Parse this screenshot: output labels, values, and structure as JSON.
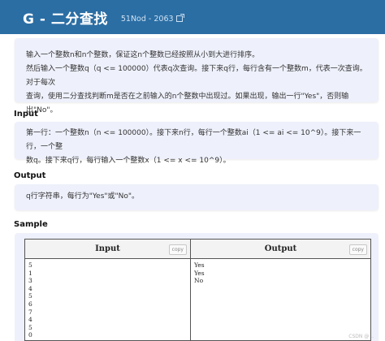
{
  "header": {
    "title": "G - 二分查找",
    "source": "51Nod - 2063"
  },
  "description": {
    "lines": [
      "输入一个整数n和n个整数，保证这n个整数已经按照从小到大进行排序。",
      "然后输入一个整数q（q <= 100000）代表q次查询。接下来q行，每行含有一个整数m，代表一次查询。对于每次",
      "查询，使用二分查找判断m是否在之前输入的n个整数中出现过。如果出现，输出一行\"Yes\"，否则输出\"No\"。"
    ]
  },
  "input_section": {
    "label": "Input",
    "lines": [
      "第一行：一个整数n（n <= 100000）。接下来n行，每行一个整数ai（1 <= ai <= 10^9）。接下来一行，一个整",
      "数q。接下来q行，每行输入一个整数x（1 <= x <= 10^9）。"
    ]
  },
  "output_section": {
    "label": "Output",
    "text": "q行字符串，每行为\"Yes\"或\"No\"。"
  },
  "sample": {
    "label": "Sample",
    "input_header": "Input",
    "output_header": "Output",
    "copy_label": "copy",
    "input_lines": [
      "5",
      "1",
      "3",
      "4",
      "5",
      "6",
      "7",
      "4",
      "5",
      "0"
    ],
    "output_lines": [
      "Yes",
      "Yes",
      "No"
    ]
  },
  "watermark": "CSDN @..."
}
